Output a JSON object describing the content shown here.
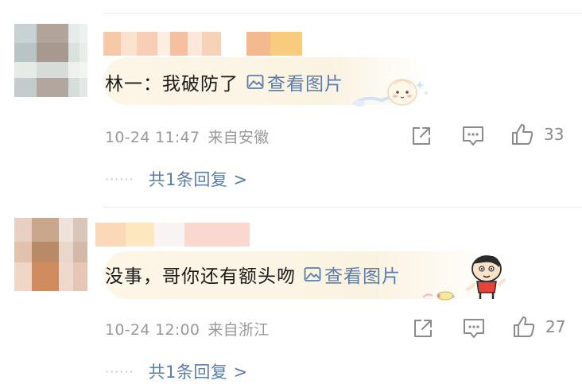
{
  "comments": [
    {
      "author": "林一",
      "separator": "：",
      "text": "我破防了",
      "image_link": "查看图片",
      "date": "10-24",
      "time": "11:47",
      "location": "来自安徽",
      "likes": "33",
      "reply_link": "共1条回复 >",
      "dots": "······"
    },
    {
      "text": "没事，哥你还有额头吻",
      "image_link": "查看图片",
      "date": "10-24",
      "time": "12:00",
      "location": "来自浙江",
      "likes": "27",
      "reply_link": "共1条回复 >",
      "dots": "······"
    }
  ],
  "icons": {
    "share": "share-icon",
    "comment": "comment-icon",
    "like": "thumbs-up-icon",
    "image": "image-icon"
  },
  "colors": {
    "link": "#5b7dab",
    "meta": "#999999",
    "text": "#1a1a1a",
    "bubble": "#fbf3e2"
  }
}
